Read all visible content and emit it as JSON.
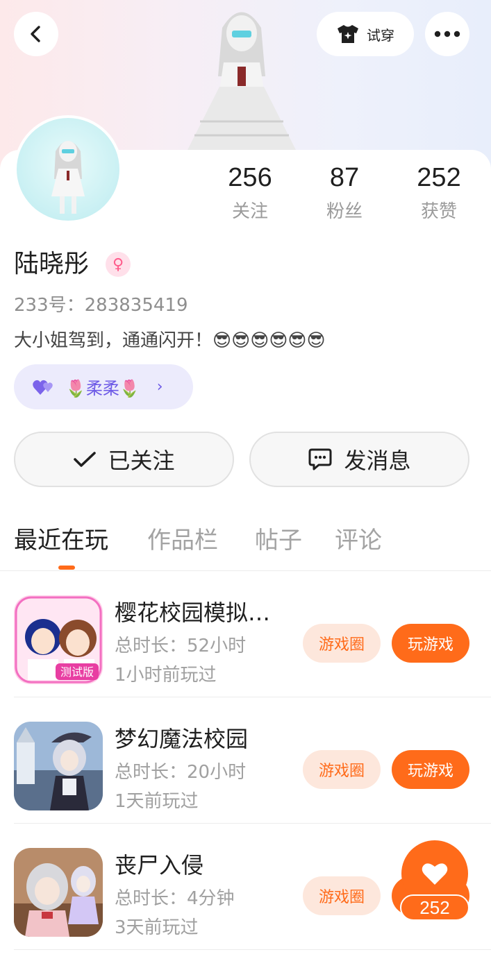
{
  "header": {
    "try_on_label": "试穿"
  },
  "profile": {
    "stats": [
      {
        "value": "256",
        "label": "关注"
      },
      {
        "value": "87",
        "label": "粉丝"
      },
      {
        "value": "252",
        "label": "获赞"
      }
    ],
    "name": "陆晓彤",
    "gender_symbol": "♀",
    "uid": "233号：283835419",
    "bio": "大小姐驾到，通通闪开！😎😎😎😎😎😎",
    "cp_tag": {
      "text": "🌷柔柔🌷"
    }
  },
  "actions": {
    "follow_label": "已关注",
    "message_label": "发消息"
  },
  "tabs": [
    {
      "label": "最近在玩",
      "active": true
    },
    {
      "label": "作品栏",
      "active": false
    },
    {
      "label": "帖子",
      "active": false
    },
    {
      "label": "评论",
      "active": false
    }
  ],
  "games": [
    {
      "name": "樱花校园模拟…",
      "duration": "总时长：52小时",
      "last_played": "1小时前玩过",
      "circle_label": "游戏圈",
      "play_label": "玩游戏"
    },
    {
      "name": "梦幻魔法校园",
      "duration": "总时长：20小时",
      "last_played": "1天前玩过",
      "circle_label": "游戏圈",
      "play_label": "玩游戏"
    },
    {
      "name": "丧尸入侵",
      "duration": "总时长：4分钟",
      "last_played": "3天前玩过",
      "circle_label": "游戏圈",
      "play_label": ""
    }
  ],
  "like": {
    "count": "252"
  },
  "colors": {
    "accent": "#ff6b1a",
    "accent_soft": "#fde7dc",
    "cp_purple": "#6d5ae6"
  }
}
